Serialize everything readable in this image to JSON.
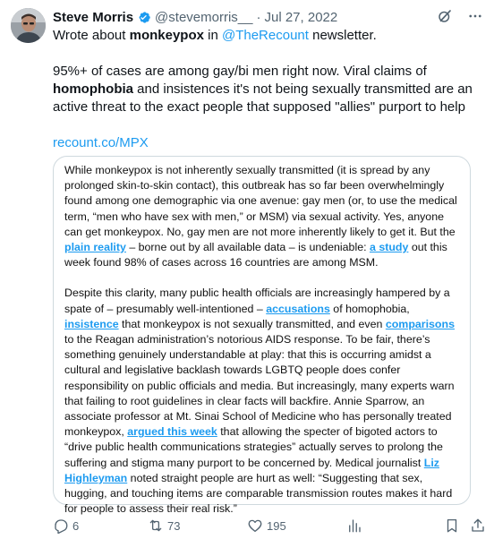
{
  "tweet": {
    "author": {
      "name": "Steve Morris",
      "handle": "@stevemorris__",
      "date": "Jul 27, 2022",
      "separator": "·",
      "verified": true
    },
    "text": {
      "line1_pre": "Wrote about ",
      "line1_bold": "monkeypox",
      "line1_mid": " in ",
      "line1_mention": "@TheRecount",
      "line1_post": " newsletter.",
      "para2_pre": "95%+ of cases are among gay/bi men right now. Viral claims of ",
      "para2_bold": "homophobia",
      "para2_post": " and insistences it's not being sexually transmitted are an active threat to the exact people that supposed \"allies\" purport to help",
      "link": "recount.co/MPX"
    }
  },
  "card": {
    "p1": {
      "t1": "While monkeypox is not inherently sexually transmitted (it is spread by any prolonged skin-to-skin contact), this outbreak has so far been overwhelmingly found among one demographic via one avenue: gay men (or, to use the medical term, “men who have sex with men,” or MSM) via sexual activity. Yes, anyone can get monkeypox. No, gay men are not more inherently likely to get it. But the ",
      "a1": "plain reality",
      "t2": " – borne out by all available data – is undeniable: ",
      "a2": "a study",
      "t3": " out this week found 98% of cases across 16 countries are among MSM."
    },
    "p2": {
      "t1": "Despite this clarity, many public health officials are increasingly hampered by a spate of – presumably well-intentioned – ",
      "a1": "accusations",
      "t2": " of homophobia, ",
      "a2": "insistence",
      "t3": " that monkeypox is not sexually transmitted, and even ",
      "a3": "comparisons",
      "t4": " to the Reagan administration’s notorious AIDS response. To be fair, there’s something genuinely understandable at play: that this is occurring amidst a cultural and legislative backlash towards LGBTQ people does confer responsibility on public officials and media. But increasingly, many experts warn that failing to root guidelines in clear facts will backfire. Annie Sparrow, an associate professor at Mt. Sinai School of Medicine who has personally treated monkeypox, ",
      "a4": "argued this week",
      "t5": " that allowing the specter of bigoted actors to “drive public health communications strategies” actually serves to prolong the suffering and stigma many purport to be concerned by. Medical journalist ",
      "a5": "Liz Highleyman",
      "t6": " noted straight people are hurt as well: “Suggesting that sex, hugging, and touching items are comparable transmission routes makes it hard for people to assess their real risk.”"
    }
  },
  "actions": {
    "replies": "6",
    "retweets": "73",
    "likes": "195"
  },
  "colors": {
    "accent": "#1d9bf0",
    "secondary_text": "#536471",
    "retweet_green": "#00ba7c",
    "border": "#cfd9de"
  },
  "icons": [
    "avatar",
    "verified-badge-icon",
    "grok-icon",
    "more-options-icon",
    "reply-icon",
    "retweet-icon",
    "like-icon",
    "views-icon",
    "bookmark-icon",
    "share-icon"
  ]
}
